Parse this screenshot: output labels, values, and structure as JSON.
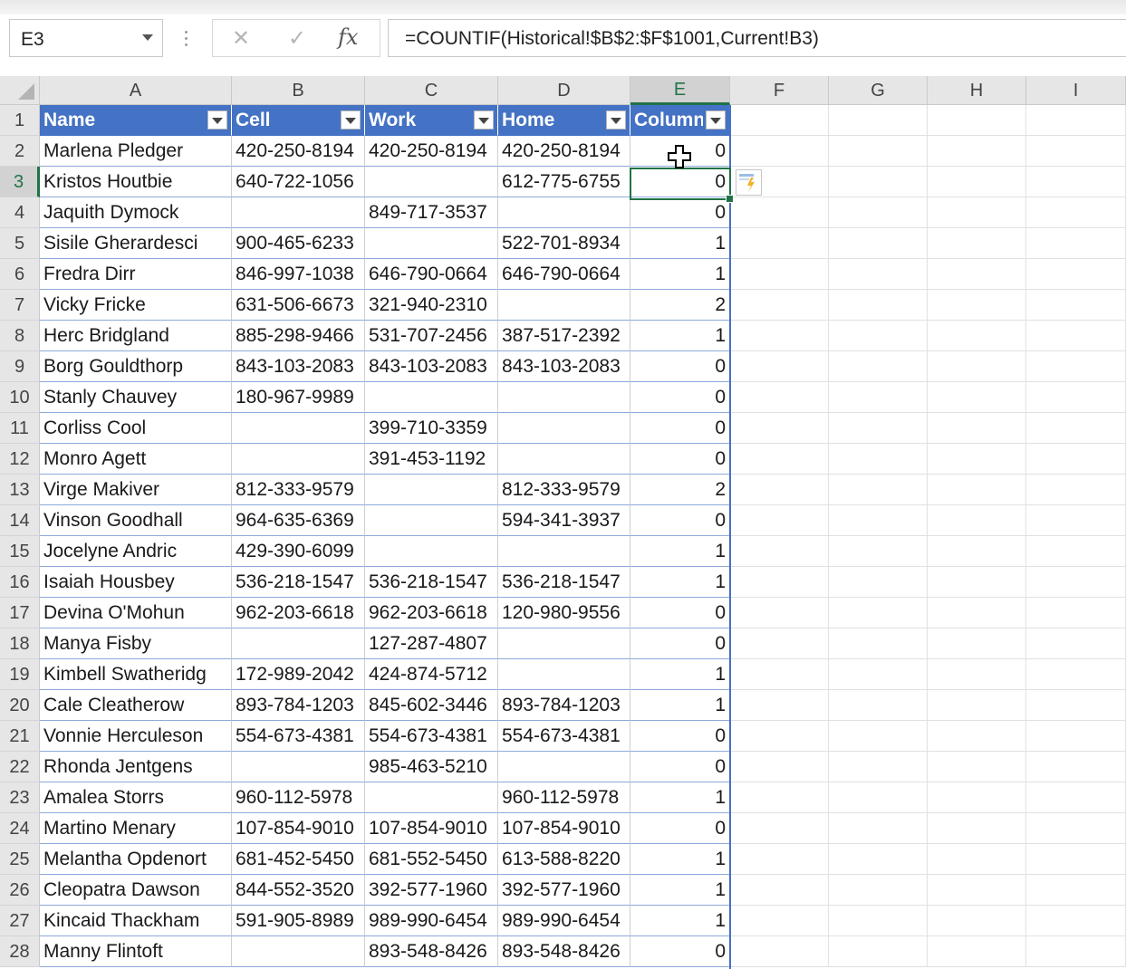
{
  "name_box": {
    "value": "E3"
  },
  "formula_bar": {
    "cancel_glyph": "✕",
    "enter_glyph": "✓",
    "fx_label": "fx",
    "formula": "=COUNTIF(Historical!$B$2:$F$1001,Current!B3)"
  },
  "columns": [
    "A",
    "B",
    "C",
    "D",
    "E",
    "F",
    "G",
    "H",
    "I"
  ],
  "active_column": "E",
  "active_row": 3,
  "table": {
    "headers": [
      "Name",
      "Cell",
      "Work",
      "Home",
      "Column1"
    ],
    "header_color": "#4472c4",
    "rows": [
      [
        "Marlena Pledger",
        "420-250-8194",
        "420-250-8194",
        "420-250-8194",
        "0"
      ],
      [
        "Kristos Houtbie",
        "640-722-1056",
        "",
        "612-775-6755",
        "0"
      ],
      [
        "Jaquith Dymock",
        "",
        "849-717-3537",
        "",
        "0"
      ],
      [
        "Sisile Gherardesci",
        "900-465-6233",
        "",
        "522-701-8934",
        "1"
      ],
      [
        "Fredra Dirr",
        "846-997-1038",
        "646-790-0664",
        "646-790-0664",
        "1"
      ],
      [
        "Vicky Fricke",
        "631-506-6673",
        "321-940-2310",
        "",
        "2"
      ],
      [
        "Herc Bridgland",
        "885-298-9466",
        "531-707-2456",
        "387-517-2392",
        "1"
      ],
      [
        "Borg Gouldthorp",
        "843-103-2083",
        "843-103-2083",
        "843-103-2083",
        "0"
      ],
      [
        "Stanly Chauvey",
        "180-967-9989",
        "",
        "",
        "0"
      ],
      [
        "Corliss Cool",
        "",
        "399-710-3359",
        "",
        "0"
      ],
      [
        "Monro Agett",
        "",
        "391-453-1192",
        "",
        "0"
      ],
      [
        "Virge Makiver",
        "812-333-9579",
        "",
        "812-333-9579",
        "2"
      ],
      [
        "Vinson Goodhall",
        "964-635-6369",
        "",
        "594-341-3937",
        "0"
      ],
      [
        "Jocelyne Andric",
        "429-390-6099",
        "",
        "",
        "1"
      ],
      [
        "Isaiah Housbey",
        "536-218-1547",
        "536-218-1547",
        "536-218-1547",
        "1"
      ],
      [
        "Devina O'Mohun",
        "962-203-6618",
        "962-203-6618",
        "120-980-9556",
        "0"
      ],
      [
        "Manya Fisby",
        "",
        "127-287-4807",
        "",
        "0"
      ],
      [
        "Kimbell Swatheridg",
        "172-989-2042",
        "424-874-5712",
        "",
        "1"
      ],
      [
        "Cale Cleatherow",
        "893-784-1203",
        "845-602-3446",
        "893-784-1203",
        "1"
      ],
      [
        "Vonnie Herculeson",
        "554-673-4381",
        "554-673-4381",
        "554-673-4381",
        "0"
      ],
      [
        "Rhonda Jentgens",
        "",
        "985-463-5210",
        "",
        "0"
      ],
      [
        "Amalea Storrs",
        "960-112-5978",
        "",
        "960-112-5978",
        "1"
      ],
      [
        "Martino Menary",
        "107-854-9010",
        "107-854-9010",
        "107-854-9010",
        "0"
      ],
      [
        "Melantha Opdenort",
        "681-452-5450",
        "681-552-5450",
        "613-588-8220",
        "1"
      ],
      [
        "Cleopatra Dawson",
        "844-552-3520",
        "392-577-1960",
        "392-577-1960",
        "1"
      ],
      [
        "Kincaid Thackham",
        "591-905-8989",
        "989-990-6454",
        "989-990-6454",
        "1"
      ],
      [
        "Manny Flintoft",
        "",
        "893-548-8426",
        "893-548-8426",
        "0"
      ]
    ]
  },
  "accent_color": "#217346"
}
